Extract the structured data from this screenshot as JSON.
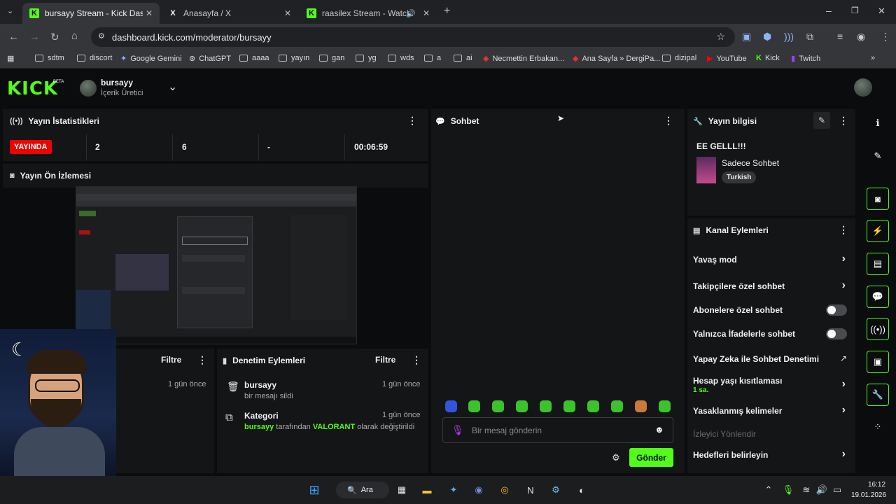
{
  "browser": {
    "tabs": [
      {
        "title": "bursayy Stream - Kick Dashboard",
        "favicon": "K"
      },
      {
        "title": "Anasayfa / X",
        "favicon": "X"
      },
      {
        "title": "raasilex Stream - Watch Live",
        "favicon": "K"
      }
    ],
    "url": "dashboard.kick.com/moderator/bursayy",
    "bookmarks": [
      "sdtm",
      "discort",
      "Google Gemini",
      "ChatGPT",
      "aaaa",
      "yayın",
      "gan",
      "yg",
      "wds",
      "a",
      "ai",
      "Necmettin Erbakan...",
      "Ana Sayfa » DergiPa...",
      "dizipal",
      "YouTube",
      "Kick",
      "Twitch"
    ]
  },
  "header": {
    "logo": "KICK",
    "beta": "BETA",
    "channel_name": "bursayy",
    "channel_role": "İçerik Üretici"
  },
  "stats": {
    "title": "Yayın İstatistikleri",
    "live_badge": "YAYINDA",
    "viewers": "2",
    "followers": "6",
    "third": "-",
    "duration": "00:06:59"
  },
  "preview": {
    "title": "Yayın Ön İzlemesi"
  },
  "left_bottom": {
    "filter": "Filtre",
    "time": "1 gün önce"
  },
  "moderation": {
    "title": "Denetim Eylemleri",
    "filter": "Filtre",
    "items": [
      {
        "title": "bursayy",
        "desc": "bir mesajı sildi",
        "time": "1 gün önce"
      },
      {
        "title": "Kategori",
        "user": "bursayy",
        "mid": "tarafından",
        "game": "VALORANT",
        "end": "olarak değiştirildi",
        "time": "1 gün önce"
      }
    ]
  },
  "chat": {
    "title": "Sohbet",
    "placeholder": "Bir mesaj gönderin",
    "send": "Gönder"
  },
  "stream_info": {
    "title": "Yayın bilgisi",
    "stream_title": "EE GELLL!!!",
    "category": "Sadece Sohbet",
    "tag": "Turkish"
  },
  "channel_actions": {
    "title": "Kanal Eylemleri",
    "items": [
      {
        "label": "Yavaş mod",
        "control": "chevron"
      },
      {
        "label": "Takipçilere özel sohbet",
        "control": "chevron"
      },
      {
        "label": "Abonelere özel sohbet",
        "control": "toggle"
      },
      {
        "label": "Yalnızca İfadelerle sohbet",
        "control": "toggle"
      },
      {
        "label": "Yapay Zeka ile Sohbet Denetimi",
        "control": "external"
      },
      {
        "label": "Hesap yaşı kısıtlaması",
        "sub": "1 sa.",
        "control": "chevron"
      },
      {
        "label": "Yasaklanmış kelimeler",
        "control": "chevron"
      },
      {
        "label": "İzleyici Yönlendir",
        "control": "none",
        "disabled": true
      },
      {
        "label": "Hedefleri belirleyin",
        "control": "chevron"
      }
    ]
  },
  "taskbar": {
    "search": "Ara",
    "time": "16:12",
    "date": "19.01.2026"
  },
  "colors": {
    "accent": "#53fc18",
    "live": "#eb0400",
    "bg": "#0b0c0d",
    "panel": "#141516"
  }
}
